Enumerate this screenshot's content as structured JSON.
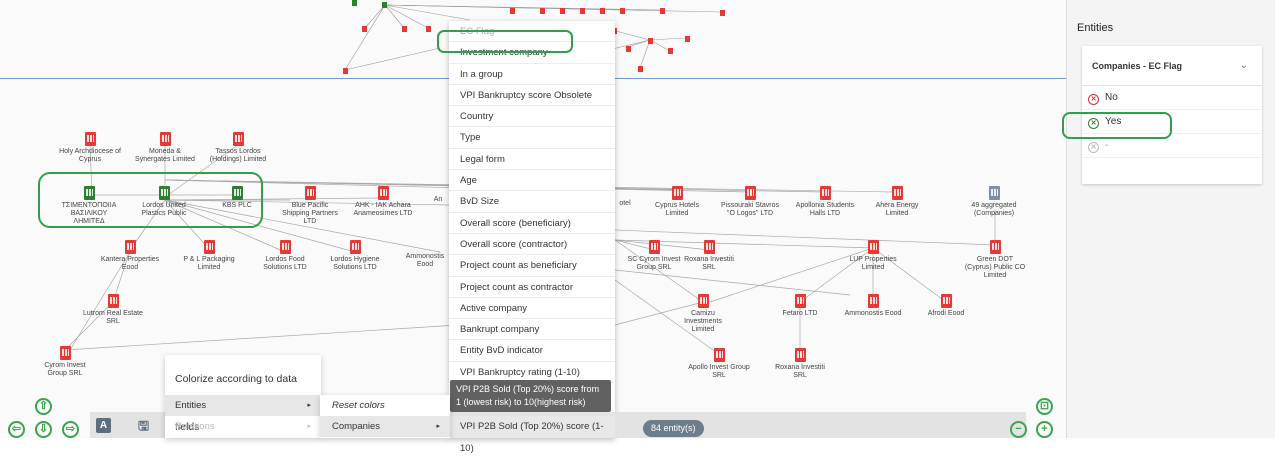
{
  "graph": {
    "nodes": [
      {
        "id": "holy",
        "label": "Holy Archdiocese of Cyprus"
      },
      {
        "id": "moneda",
        "label": "Moneda & Synergates Limited"
      },
      {
        "id": "tassos",
        "label": "Tassos Lordos (Holdings) Limited"
      },
      {
        "id": "tsim",
        "label": "ΤΣΙΜΕΝΤΟΠΟΙΙΑ ΒΑΣΙΛΙΚΟΥ ΛΗΜΙΤΕΔ"
      },
      {
        "id": "lordosunited",
        "label": "Lordos United Plastics Public"
      },
      {
        "id": "kbs",
        "label": "KBS PLC"
      },
      {
        "id": "bluepacific",
        "label": "Blue Pacific Shipping Partners LTD"
      },
      {
        "id": "ahk",
        "label": "AHK - IAK Achara Anameosimes LTD"
      },
      {
        "id": "cyprushotels",
        "label": "Cyprus Hotels Limited"
      },
      {
        "id": "pissouri",
        "label": "Pissouraki Stavros \"O Logos\" LTD"
      },
      {
        "id": "apollonia",
        "label": "Apollonia Students Halls LTD"
      },
      {
        "id": "ahera",
        "label": "Ahera Energy Limited"
      },
      {
        "id": "agg",
        "label": "49 aggregated (Companies)"
      },
      {
        "id": "kantera",
        "label": "Kantera Properties Eood"
      },
      {
        "id": "pl",
        "label": "P & L Packaging Limited"
      },
      {
        "id": "lordosfood",
        "label": "Lordos Food Solutions LTD"
      },
      {
        "id": "lordoshyg",
        "label": "Lordos Hygiene Solutions LTD"
      },
      {
        "id": "ammono",
        "label": "Ammonostis Eood"
      },
      {
        "id": "sccyrom",
        "label": "SC Cyrom Invest Group SRL"
      },
      {
        "id": "roxana1",
        "label": "Roxana Investiti SRL"
      },
      {
        "id": "lup",
        "label": "LUP Properties Limited"
      },
      {
        "id": "greendot",
        "label": "Green DOT (Cyprus) Public CO Limited"
      },
      {
        "id": "lutrom",
        "label": "Lutrom Real Estate SRL"
      },
      {
        "id": "camizu",
        "label": "Camizu Investments Limited"
      },
      {
        "id": "fetaro",
        "label": "Fetaro LTD"
      },
      {
        "id": "ammon2",
        "label": "Ammonostis Eood"
      },
      {
        "id": "afrodi",
        "label": "Afrodi Eood"
      },
      {
        "id": "cyrominv",
        "label": "Cyrom Invest Group SRL"
      },
      {
        "id": "apollo",
        "label": "Apollo Invest Group SRL"
      },
      {
        "id": "roxana2",
        "label": "Roxana Investiti SRL"
      }
    ],
    "partial_labels": {
      "hotel_fragment": "otel",
      "an_fragment": "An",
      "a_fragment": "A"
    }
  },
  "dropdown": {
    "items": [
      "EC Flag",
      "Investment company",
      "In a group",
      "VPI Bankruptcy score Obsolete",
      "Country",
      "Type",
      "Legal form",
      "Age",
      "BvD Size",
      "Overall score (beneficiary)",
      "Overall score (contractor)",
      "Project count as beneficiary",
      "Project count as contractor",
      "Active company",
      "Bankrupt company",
      "Entity BvD indicator",
      "VPI Bankruptcy rating (1-10)"
    ],
    "tooltip": "VPI P2B Sold (Top 20%) score from 1 (lowest risk) to 10(highest risk)",
    "footer_item": "VPI P2B Sold (Top 20%) score (1-10)"
  },
  "colorize": {
    "title": "Colorize according to data fields",
    "rows": [
      "Entities",
      "Relations"
    ]
  },
  "submenu": {
    "items": [
      "Reset colors",
      "Companies"
    ]
  },
  "toolbar": {
    "text_btn": "A",
    "save_btn": "🖫",
    "count_badge": "84 entity(s)"
  },
  "panel": {
    "title": "Entities",
    "card_title": "Companies - EC Flag",
    "options": [
      "No",
      "Yes",
      "-"
    ]
  },
  "colors": {
    "red_node": "#e53935",
    "green_node": "#2e7d32",
    "highlight": "#2fa04a",
    "separator": "#6a9ad8"
  }
}
